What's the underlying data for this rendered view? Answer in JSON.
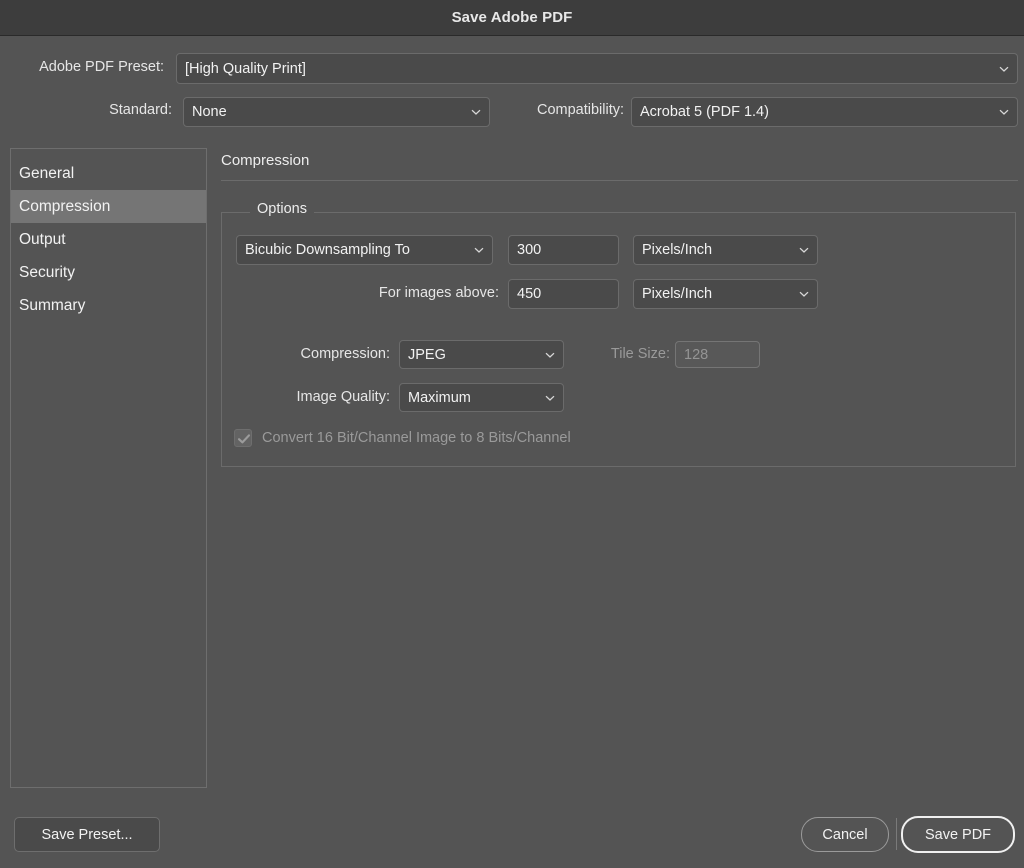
{
  "window": {
    "title": "Save Adobe PDF"
  },
  "header": {
    "preset_label": "Adobe PDF Preset:",
    "preset_value": "[High Quality Print]",
    "standard_label": "Standard:",
    "standard_value": "None",
    "compatibility_label": "Compatibility:",
    "compatibility_value": "Acrobat 5 (PDF 1.4)"
  },
  "sidebar": {
    "items": [
      {
        "label": "General",
        "selected": false
      },
      {
        "label": "Compression",
        "selected": true
      },
      {
        "label": "Output",
        "selected": false
      },
      {
        "label": "Security",
        "selected": false
      },
      {
        "label": "Summary",
        "selected": false
      }
    ]
  },
  "pane": {
    "title": "Compression",
    "group_legend": "Options",
    "downsample_method": "Bicubic Downsampling To",
    "downsample_value": "300",
    "downsample_unit": "Pixels/Inch",
    "for_images_above_label": "For images above:",
    "for_images_above_value": "450",
    "for_images_above_unit": "Pixels/Inch",
    "compression_label": "Compression:",
    "compression_value": "JPEG",
    "tile_size_label": "Tile Size:",
    "tile_size_value": "128",
    "image_quality_label": "Image Quality:",
    "image_quality_value": "Maximum",
    "convert_checkbox_label": "Convert 16 Bit/Channel Image to 8 Bits/Channel",
    "convert_checkbox_checked": true
  },
  "footer": {
    "save_preset_label": "Save Preset...",
    "cancel_label": "Cancel",
    "save_pdf_label": "Save PDF"
  },
  "colors": {
    "window_background": "#545454",
    "titlebar_background": "#3d3d3d",
    "control_background": "#4a4a4a",
    "control_border": "#6b6b6b",
    "selection_background": "#757575",
    "text": "#f0f0f0",
    "disabled_text": "#9a9a9a"
  }
}
